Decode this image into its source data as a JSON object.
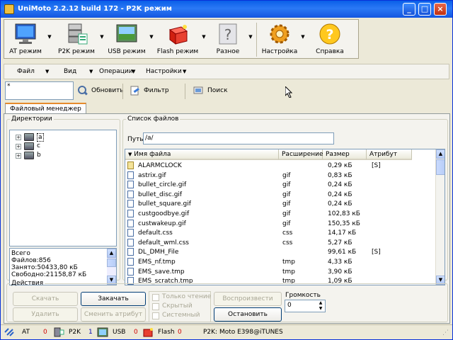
{
  "window": {
    "title": "UniMoto 2.2.12 build 172 - P2K режим"
  },
  "big_toolbar": [
    {
      "label": "AT режим",
      "icon": "monitor-icon"
    },
    {
      "label": "P2K режим",
      "icon": "server-icon"
    },
    {
      "label": "USB режим",
      "icon": "usb-screen-icon"
    },
    {
      "label": "Flash режим",
      "icon": "flash-box-icon"
    },
    {
      "label": "Разное",
      "icon": "question-page-icon"
    },
    {
      "label": "Настройка",
      "icon": "gear-icon"
    },
    {
      "label": "Справка",
      "icon": "help-icon"
    }
  ],
  "menu": [
    "Файл",
    "Вид",
    "Операции",
    "Настройки"
  ],
  "toolbar": {
    "search_value": "*",
    "refresh": "Обновить",
    "filter": "Фильтр",
    "search": "Поиск"
  },
  "tabs": {
    "file_manager": "Файловый менеджер"
  },
  "directories": {
    "legend": "Директории",
    "items": [
      "a",
      "c",
      "b"
    ],
    "stats": {
      "total": "Всего",
      "files": "Файлов:856",
      "used": "Занято:50433,80 кБ",
      "free": "Свободно:21158,87 кБ"
    }
  },
  "file_list": {
    "legend": "Список файлов",
    "path_label": "Путь",
    "path_value": "/a/",
    "columns": [
      "Имя файла",
      "Расширение",
      "Размер",
      "Атрибут"
    ],
    "rows": [
      {
        "name": "ALARMCLOCK",
        "ext": "",
        "size": "0,29 кБ",
        "attr": "[S]",
        "kind": "folder"
      },
      {
        "name": "astrix.gif",
        "ext": "gif",
        "size": "0,83 кБ",
        "attr": "",
        "kind": "file"
      },
      {
        "name": "bullet_circle.gif",
        "ext": "gif",
        "size": "0,24 кБ",
        "attr": "",
        "kind": "file"
      },
      {
        "name": "bullet_disc.gif",
        "ext": "gif",
        "size": "0,24 кБ",
        "attr": "",
        "kind": "file"
      },
      {
        "name": "bullet_square.gif",
        "ext": "gif",
        "size": "0,24 кБ",
        "attr": "",
        "kind": "file"
      },
      {
        "name": "custgoodbye.gif",
        "ext": "gif",
        "size": "102,83 кБ",
        "attr": "",
        "kind": "file"
      },
      {
        "name": "custwakeup.gif",
        "ext": "gif",
        "size": "150,35 кБ",
        "attr": "",
        "kind": "file"
      },
      {
        "name": "default.css",
        "ext": "css",
        "size": "14,17 кБ",
        "attr": "",
        "kind": "file"
      },
      {
        "name": "default_wml.css",
        "ext": "css",
        "size": "5,27 кБ",
        "attr": "",
        "kind": "file"
      },
      {
        "name": "DL_DMH_File",
        "ext": "",
        "size": "99,61 кБ",
        "attr": "[S]",
        "kind": "file"
      },
      {
        "name": "EMS_nf.tmp",
        "ext": "tmp",
        "size": "4,33 кБ",
        "attr": "",
        "kind": "file"
      },
      {
        "name": "EMS_save.tmp",
        "ext": "tmp",
        "size": "3,90 кБ",
        "attr": "",
        "kind": "file"
      },
      {
        "name": "EMS_scratch.tmp",
        "ext": "tmp",
        "size": "1,09 кБ",
        "attr": "",
        "kind": "file"
      }
    ]
  },
  "actions": {
    "legend": "Действия",
    "download": "Скачать",
    "upload": "Закачать",
    "delete": "Удалить",
    "change_attr": "Сменить атрибут",
    "readonly": "Только чтение",
    "hidden": "Скрытый",
    "system": "Системный",
    "play": "Воспроизвести",
    "stop": "Остановить",
    "volume_label": "Громкость",
    "volume_value": "0"
  },
  "status": {
    "at_label": "AT",
    "at_count": "0",
    "p2k_label": "P2K",
    "p2k_count": "1",
    "usb_label": "USB",
    "usb_count": "0",
    "flash_label": "Flash",
    "flash_count": "0",
    "device": "P2K: Moto E398@iTUNES"
  }
}
